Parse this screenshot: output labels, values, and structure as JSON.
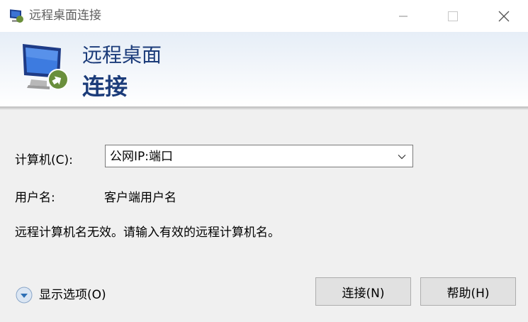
{
  "window": {
    "title": "远程桌面连接",
    "controls": {
      "minimize": "minimize-icon",
      "maximize": "maximize-icon",
      "close": "close-icon"
    }
  },
  "banner": {
    "line1": "远程桌面",
    "line2": "连接",
    "icon": "remote-desktop-monitor-icon"
  },
  "form": {
    "computer_label": "计算机(C):",
    "computer_value": "公网IP:端口",
    "username_label": "用户名:",
    "username_value": "客户端用户名",
    "message": "远程计算机名无效。请输入有效的远程计算机名。"
  },
  "footer": {
    "show_options_label": "显示选项(O)",
    "connect_label": "连接(N)",
    "help_label": "帮助(H)"
  },
  "colors": {
    "banner_text": "#1c3c7a",
    "dialog_bg": "#f0f0f0",
    "accent": "#2d6fb5"
  }
}
